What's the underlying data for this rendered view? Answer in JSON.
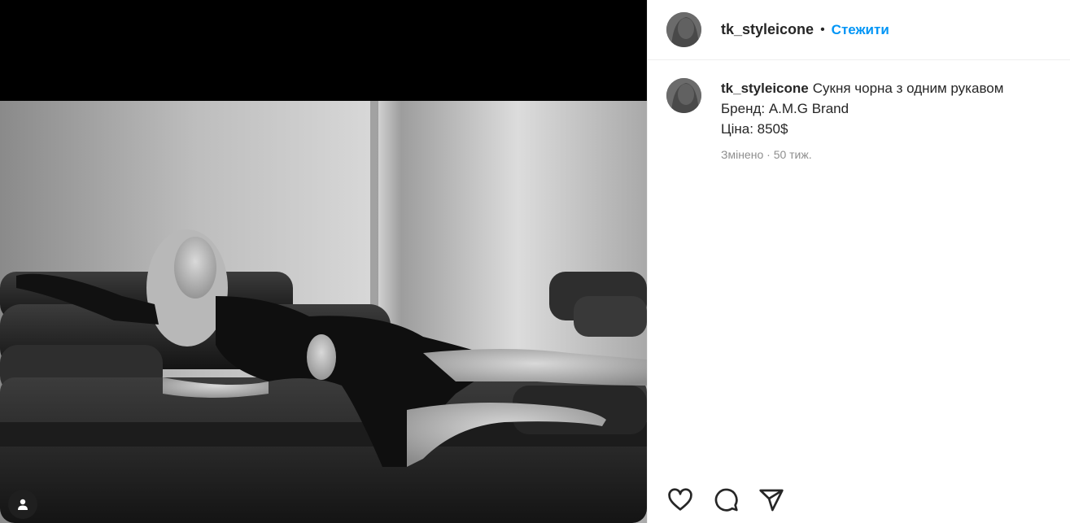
{
  "post": {
    "username": "tk_styleicone",
    "dot": "•",
    "follow_label": "Стежити",
    "caption": {
      "username": "tk_styleicone",
      "line1": "Сукня чорна з одним рукавом",
      "line2": "Бренд: A.M.G Brand",
      "line3": "Ціна: 850$"
    },
    "meta": {
      "edited": "Змінено",
      "separator": " · ",
      "age": "50 тиж."
    }
  },
  "icons": {
    "like": "heart-icon",
    "comment": "comment-icon",
    "share": "send-icon",
    "tag": "user-tag-icon"
  },
  "colors": {
    "accent": "#0095f6",
    "text": "#262626",
    "secondary": "#8e8e8e"
  }
}
